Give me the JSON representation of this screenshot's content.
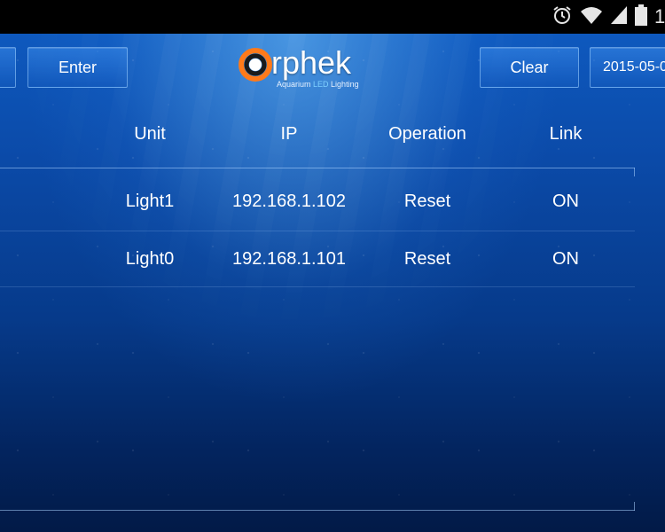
{
  "status_bar": {
    "time_partial": "1",
    "icons": [
      "alarm-icon",
      "wifi-icon",
      "signal-icon",
      "battery-icon"
    ]
  },
  "toolbar": {
    "enter_label": "Enter",
    "clear_label": "Clear",
    "date_label": "2015-05-0"
  },
  "logo": {
    "word_rest": "rphek",
    "tag_pre": "Aquarium ",
    "tag_led": "LED",
    "tag_post": " Lighting"
  },
  "table": {
    "headers": {
      "unit": "Unit",
      "ip": "IP",
      "operation": "Operation",
      "link": "Link"
    },
    "rows": [
      {
        "unit": "Light1",
        "ip": "192.168.1.102",
        "operation": "Reset",
        "link": "ON"
      },
      {
        "unit": "Light0",
        "ip": "192.168.1.101",
        "operation": "Reset",
        "link": "ON"
      }
    ]
  },
  "colors": {
    "status_bar_bg": "#000000",
    "background_top": "#0f5dc4",
    "background_bottom": "#021a47",
    "text": "#ffffff"
  }
}
